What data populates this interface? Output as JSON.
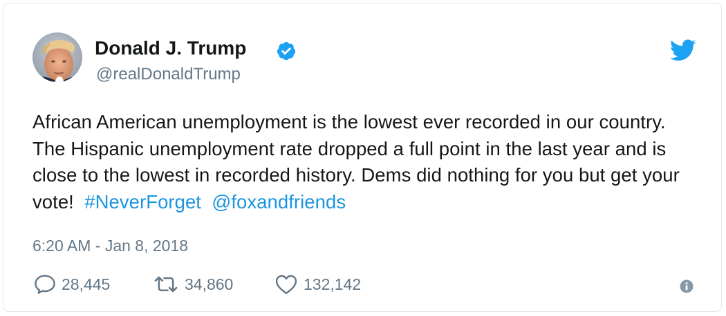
{
  "author": {
    "display_name": "Donald J. Trump",
    "handle": "@realDonaldTrump",
    "verified": true
  },
  "tweet": {
    "text_before_links": "African American unemployment is the lowest ever recorded in our country. The Hispanic unemployment rate dropped a full point in the last year and is close to the lowest in recorded history. Dems did nothing for you but get your vote!",
    "hashtag": "#NeverForget",
    "mention": "@foxandfriends",
    "timestamp": "6:20 AM - Jan 8, 2018"
  },
  "actions": {
    "replies": "28,445",
    "retweets": "34,860",
    "likes": "132,142"
  },
  "icons": {
    "brand": "twitter-bird-icon",
    "verified": "verified-badge-icon",
    "reply": "reply-icon",
    "retweet": "retweet-icon",
    "like": "heart-icon",
    "info": "info-icon"
  },
  "colors": {
    "brand_blue": "#1da1f2",
    "link_blue": "#1b95e0",
    "text": "#14171a",
    "secondary_text": "#657786",
    "border": "#e1e8ed"
  }
}
